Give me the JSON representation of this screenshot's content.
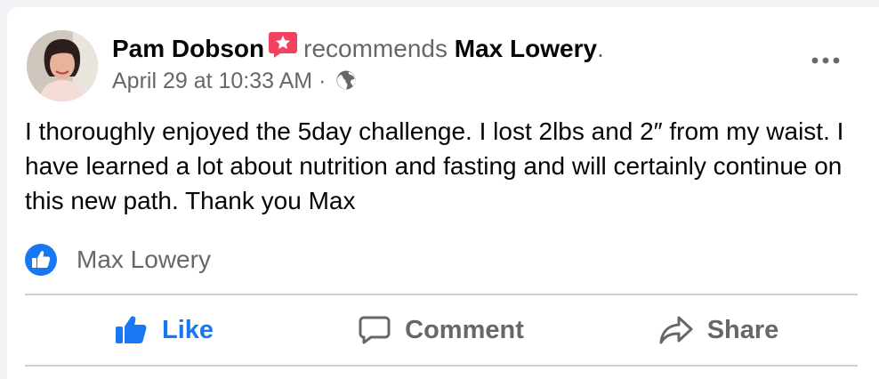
{
  "post": {
    "author_name": "Pam Dobson",
    "recommends_text": "recommends",
    "page_name": "Max Lowery",
    "period": ".",
    "timestamp": "April 29 at 10:33 AM",
    "separator": "·",
    "audience_icon": "globe-icon",
    "recommend_icon": "recommend-star-icon",
    "more_icon": "more-options-icon",
    "body": "I thoroughly enjoyed the 5day challenge. I lost 2lbs and 2″ from my waist. I have learned a lot about nutrition and fasting and will certainly continue on this new path. Thank you Max"
  },
  "reactions": {
    "icon": "like-badge-icon",
    "liked_by": "Max Lowery"
  },
  "actions": {
    "like_label": "Like",
    "comment_label": "Comment",
    "share_label": "Share"
  },
  "colors": {
    "brand_blue": "#1877f2",
    "recommend_pink": "#f3425f",
    "secondary_text": "#65676b",
    "primary_text": "#050505",
    "divider": "#ced0d4"
  }
}
